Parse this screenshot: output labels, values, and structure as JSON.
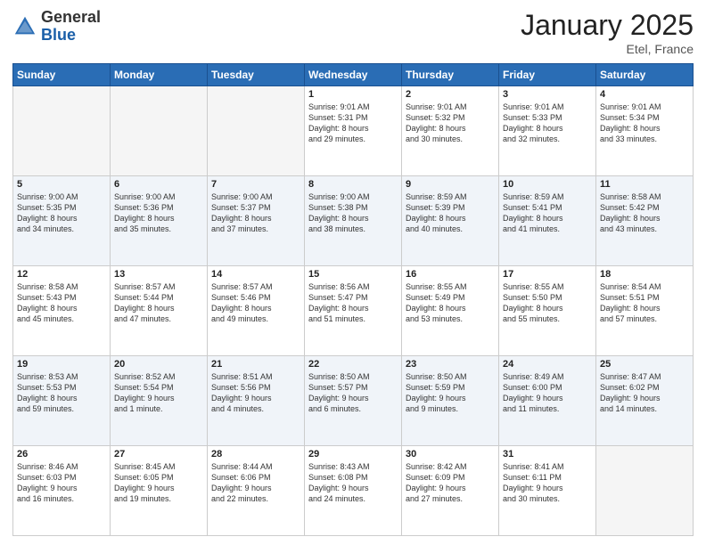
{
  "header": {
    "logo_general": "General",
    "logo_blue": "Blue",
    "month": "January 2025",
    "location": "Etel, France"
  },
  "weekdays": [
    "Sunday",
    "Monday",
    "Tuesday",
    "Wednesday",
    "Thursday",
    "Friday",
    "Saturday"
  ],
  "weeks": [
    [
      {
        "day": "",
        "info": ""
      },
      {
        "day": "",
        "info": ""
      },
      {
        "day": "",
        "info": ""
      },
      {
        "day": "1",
        "info": "Sunrise: 9:01 AM\nSunset: 5:31 PM\nDaylight: 8 hours\nand 29 minutes."
      },
      {
        "day": "2",
        "info": "Sunrise: 9:01 AM\nSunset: 5:32 PM\nDaylight: 8 hours\nand 30 minutes."
      },
      {
        "day": "3",
        "info": "Sunrise: 9:01 AM\nSunset: 5:33 PM\nDaylight: 8 hours\nand 32 minutes."
      },
      {
        "day": "4",
        "info": "Sunrise: 9:01 AM\nSunset: 5:34 PM\nDaylight: 8 hours\nand 33 minutes."
      }
    ],
    [
      {
        "day": "5",
        "info": "Sunrise: 9:00 AM\nSunset: 5:35 PM\nDaylight: 8 hours\nand 34 minutes."
      },
      {
        "day": "6",
        "info": "Sunrise: 9:00 AM\nSunset: 5:36 PM\nDaylight: 8 hours\nand 35 minutes."
      },
      {
        "day": "7",
        "info": "Sunrise: 9:00 AM\nSunset: 5:37 PM\nDaylight: 8 hours\nand 37 minutes."
      },
      {
        "day": "8",
        "info": "Sunrise: 9:00 AM\nSunset: 5:38 PM\nDaylight: 8 hours\nand 38 minutes."
      },
      {
        "day": "9",
        "info": "Sunrise: 8:59 AM\nSunset: 5:39 PM\nDaylight: 8 hours\nand 40 minutes."
      },
      {
        "day": "10",
        "info": "Sunrise: 8:59 AM\nSunset: 5:41 PM\nDaylight: 8 hours\nand 41 minutes."
      },
      {
        "day": "11",
        "info": "Sunrise: 8:58 AM\nSunset: 5:42 PM\nDaylight: 8 hours\nand 43 minutes."
      }
    ],
    [
      {
        "day": "12",
        "info": "Sunrise: 8:58 AM\nSunset: 5:43 PM\nDaylight: 8 hours\nand 45 minutes."
      },
      {
        "day": "13",
        "info": "Sunrise: 8:57 AM\nSunset: 5:44 PM\nDaylight: 8 hours\nand 47 minutes."
      },
      {
        "day": "14",
        "info": "Sunrise: 8:57 AM\nSunset: 5:46 PM\nDaylight: 8 hours\nand 49 minutes."
      },
      {
        "day": "15",
        "info": "Sunrise: 8:56 AM\nSunset: 5:47 PM\nDaylight: 8 hours\nand 51 minutes."
      },
      {
        "day": "16",
        "info": "Sunrise: 8:55 AM\nSunset: 5:49 PM\nDaylight: 8 hours\nand 53 minutes."
      },
      {
        "day": "17",
        "info": "Sunrise: 8:55 AM\nSunset: 5:50 PM\nDaylight: 8 hours\nand 55 minutes."
      },
      {
        "day": "18",
        "info": "Sunrise: 8:54 AM\nSunset: 5:51 PM\nDaylight: 8 hours\nand 57 minutes."
      }
    ],
    [
      {
        "day": "19",
        "info": "Sunrise: 8:53 AM\nSunset: 5:53 PM\nDaylight: 8 hours\nand 59 minutes."
      },
      {
        "day": "20",
        "info": "Sunrise: 8:52 AM\nSunset: 5:54 PM\nDaylight: 9 hours\nand 1 minute."
      },
      {
        "day": "21",
        "info": "Sunrise: 8:51 AM\nSunset: 5:56 PM\nDaylight: 9 hours\nand 4 minutes."
      },
      {
        "day": "22",
        "info": "Sunrise: 8:50 AM\nSunset: 5:57 PM\nDaylight: 9 hours\nand 6 minutes."
      },
      {
        "day": "23",
        "info": "Sunrise: 8:50 AM\nSunset: 5:59 PM\nDaylight: 9 hours\nand 9 minutes."
      },
      {
        "day": "24",
        "info": "Sunrise: 8:49 AM\nSunset: 6:00 PM\nDaylight: 9 hours\nand 11 minutes."
      },
      {
        "day": "25",
        "info": "Sunrise: 8:47 AM\nSunset: 6:02 PM\nDaylight: 9 hours\nand 14 minutes."
      }
    ],
    [
      {
        "day": "26",
        "info": "Sunrise: 8:46 AM\nSunset: 6:03 PM\nDaylight: 9 hours\nand 16 minutes."
      },
      {
        "day": "27",
        "info": "Sunrise: 8:45 AM\nSunset: 6:05 PM\nDaylight: 9 hours\nand 19 minutes."
      },
      {
        "day": "28",
        "info": "Sunrise: 8:44 AM\nSunset: 6:06 PM\nDaylight: 9 hours\nand 22 minutes."
      },
      {
        "day": "29",
        "info": "Sunrise: 8:43 AM\nSunset: 6:08 PM\nDaylight: 9 hours\nand 24 minutes."
      },
      {
        "day": "30",
        "info": "Sunrise: 8:42 AM\nSunset: 6:09 PM\nDaylight: 9 hours\nand 27 minutes."
      },
      {
        "day": "31",
        "info": "Sunrise: 8:41 AM\nSunset: 6:11 PM\nDaylight: 9 hours\nand 30 minutes."
      },
      {
        "day": "",
        "info": ""
      }
    ]
  ]
}
